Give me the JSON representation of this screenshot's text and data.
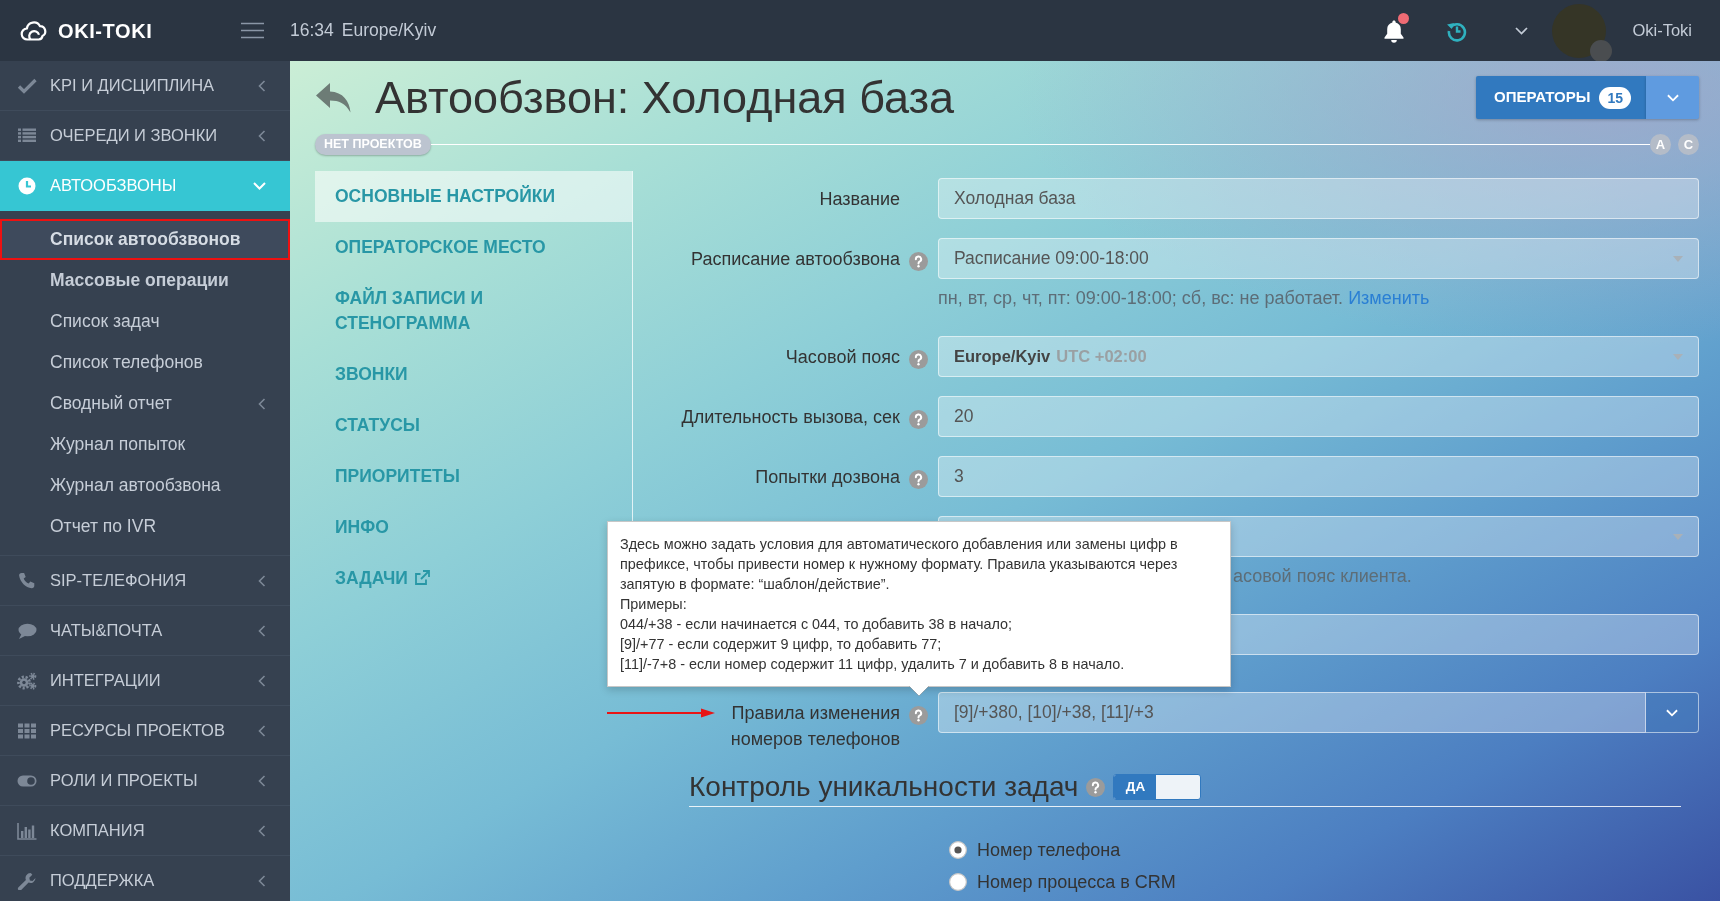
{
  "topbar": {
    "logo": "OKI-TOKI",
    "time": "16:34",
    "timezone": "Europe/Kyiv",
    "unread_notifications": true,
    "user": "Oki-Toki"
  },
  "sidebar": {
    "items": [
      {
        "label": "KPI И ДИСЦИПЛИНА",
        "selected": false,
        "expanded": false
      },
      {
        "label": "ОЧЕРЕДИ И ЗВОНКИ",
        "selected": false,
        "expanded": false
      },
      {
        "label": "АВТООБЗВОНЫ",
        "selected": true,
        "expanded": true,
        "children": [
          {
            "label": "Список автообзвонов",
            "selected": true,
            "bold": true,
            "annotated": true,
            "expandable": false
          },
          {
            "label": "Массовые операции",
            "selected": false,
            "bold": true,
            "annotated": false,
            "expandable": false
          },
          {
            "label": "Список задач",
            "selected": false,
            "bold": false,
            "annotated": false,
            "expandable": false
          },
          {
            "label": "Список телефонов",
            "selected": false,
            "bold": false,
            "annotated": false,
            "expandable": false
          },
          {
            "label": "Сводный отчет",
            "selected": false,
            "bold": false,
            "annotated": false,
            "expandable": true
          },
          {
            "label": "Журнал попыток",
            "selected": false,
            "bold": false,
            "annotated": false,
            "expandable": false
          },
          {
            "label": "Журнал автообзвона",
            "selected": false,
            "bold": false,
            "annotated": false,
            "expandable": false
          },
          {
            "label": "Отчет по IVR",
            "selected": false,
            "bold": false,
            "annotated": false,
            "expandable": false
          }
        ]
      },
      {
        "label": "SIP-ТЕЛЕФОНИЯ",
        "selected": false,
        "expanded": false
      },
      {
        "label": "ЧАТЫ&ПОЧТА",
        "selected": false,
        "expanded": false
      },
      {
        "label": "ИНТЕГРАЦИИ",
        "selected": false,
        "expanded": false
      },
      {
        "label": "РЕСУРСЫ ПРОЕКТОВ",
        "selected": false,
        "expanded": false
      },
      {
        "label": "РОЛИ И ПРОЕКТЫ",
        "selected": false,
        "expanded": false
      },
      {
        "label": "КОМПАНИЯ",
        "selected": false,
        "expanded": false
      },
      {
        "label": "ПОДДЕРЖКА",
        "selected": false,
        "expanded": false
      }
    ]
  },
  "page": {
    "title": "Автообзвон: Холодная база",
    "operators": {
      "label": "ОПЕРАТОРЫ",
      "count": "15"
    },
    "projects": {
      "label": "НЕТ ПРОЕКТОВ",
      "markers": [
        "A",
        "C"
      ]
    }
  },
  "tabs": [
    {
      "label": "ОСНОВНЫЕ НАСТРОЙКИ",
      "selected": true,
      "external": false
    },
    {
      "label": "ОПЕРАТОРСКОЕ МЕСТО",
      "selected": false,
      "external": false
    },
    {
      "label": "ФАЙЛ ЗАПИСИ И СТЕНОГРАММА",
      "selected": false,
      "external": false
    },
    {
      "label": "ЗВОНКИ",
      "selected": false,
      "external": false
    },
    {
      "label": "СТАТУСЫ",
      "selected": false,
      "external": false
    },
    {
      "label": "ПРИОРИТЕТЫ",
      "selected": false,
      "external": false
    },
    {
      "label": "ИНФО",
      "selected": false,
      "external": false
    },
    {
      "label": "ЗАДАЧИ",
      "selected": false,
      "external": true
    }
  ],
  "fields": [
    {
      "kind": "input",
      "label": "Название",
      "help": false,
      "annotated": false,
      "value": "Холодная база"
    },
    {
      "kind": "select",
      "label": "Расписание автообзвона",
      "help": true,
      "annotated": false,
      "value": "Расписание 09:00-18:00",
      "hint": "пн, вт, ср, чт, пт: 09:00-18:00; сб, вс: не работает.",
      "hint_link": "Изменить"
    },
    {
      "kind": "timezone",
      "label": "Часовой пояс",
      "help": true,
      "annotated": false,
      "value": "Europe/Kyiv",
      "value_note": "UTC +02:00"
    },
    {
      "kind": "input",
      "label": "Длительность вызова, сек",
      "help": true,
      "annotated": false,
      "value": "20"
    },
    {
      "kind": "input",
      "label": "Попытки дозвона",
      "help": true,
      "annotated": false,
      "value": "3"
    },
    {
      "kind": "select",
      "help": false,
      "annotated": false,
      "hint": "асовой пояс клиента."
    },
    {
      "kind": "input",
      "help": false,
      "annotated": false
    },
    {
      "kind": "multi",
      "label": "Правила изменения номеров телефонов",
      "help": true,
      "annotated": true,
      "value": "[9]/+380, [10]/+38, [11]/+3",
      "tooltip": {
        "text": "Здесь можно задать условия для автоматического добавления или замены цифр в префиксе, чтобы привести номер к нужному формату. Правила указываются через запятую в формате: “шаблон/действие”.",
        "lines": [
          "Примеры:",
          "044/+38 - если начинается с 044, то добавить 38 в начало;",
          "[9]/+77 - если содержит 9 цифр, то добавить 77;",
          "[11]/-7+8 - если номер содержит 11 цифр, удалить 7 и добавить 8 в начало."
        ]
      }
    }
  ],
  "uniqueness": {
    "title": "Контроль уникальности задач",
    "help": true,
    "toggle": {
      "label": "ДА",
      "on": true
    },
    "options": [
      {
        "label": "Номер телефона",
        "selected": true
      },
      {
        "label": "Номер процесса в CRM",
        "selected": false
      }
    ]
  }
}
